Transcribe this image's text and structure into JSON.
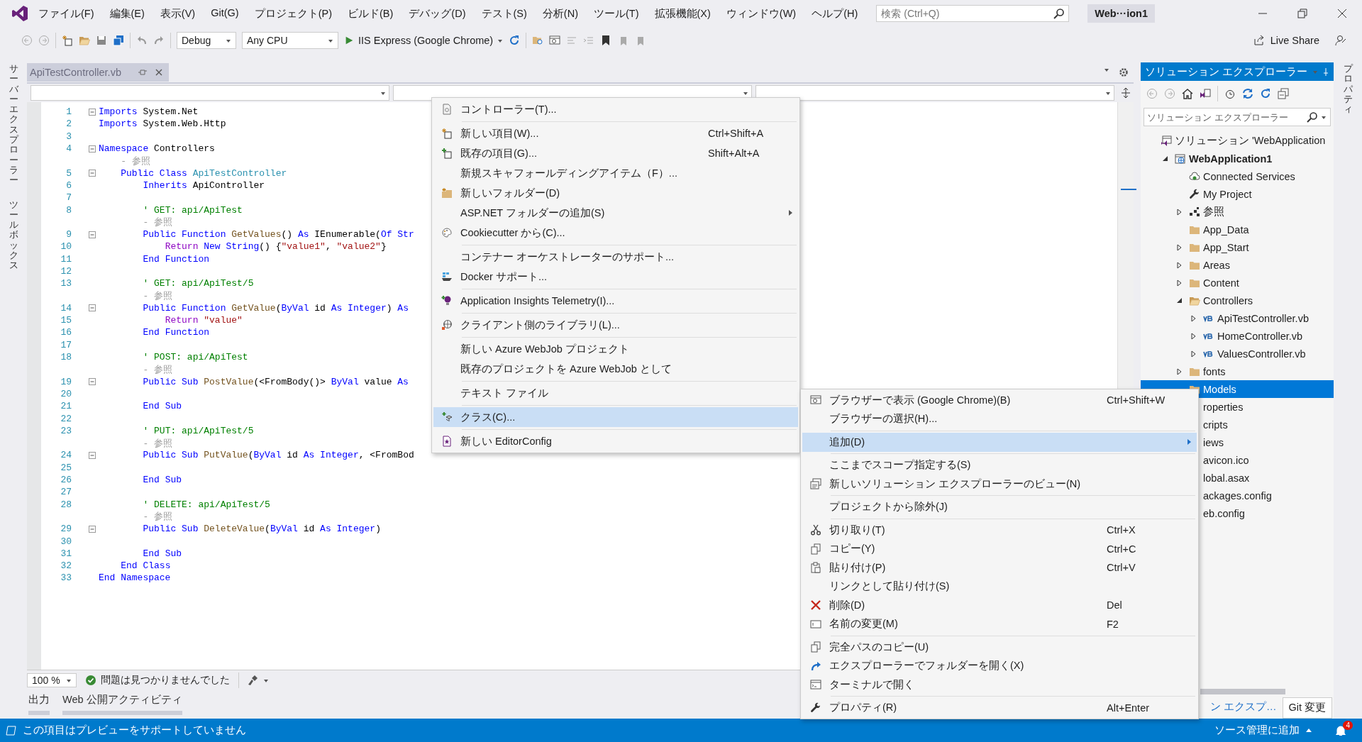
{
  "menu_bar": [
    "ファイル(F)",
    "編集(E)",
    "表示(V)",
    "Git(G)",
    "プロジェクト(P)",
    "ビルド(B)",
    "デバッグ(D)",
    "テスト(S)",
    "分析(N)",
    "ツール(T)",
    "拡張機能(X)",
    "ウィンドウ(W)",
    "ヘルプ(H)"
  ],
  "search": {
    "placeholder": "検索 (Ctrl+Q)"
  },
  "solution_badge": "Web···ion1",
  "toolbar": {
    "configuration": "Debug",
    "platform": "Any CPU",
    "run_target": "IIS Express (Google Chrome)",
    "live_share": "Live Share"
  },
  "side_tabs_left": [
    "サーバーエクスプローラー",
    "ツールボックス"
  ],
  "side_tabs_right": [
    "プロパティ"
  ],
  "document_tabs": [
    {
      "label": "ApiTestController.vb"
    }
  ],
  "editor": {
    "lines": [
      {
        "n": "1",
        "fold": true,
        "code": [
          {
            "kind": "keyword",
            "text": "Imports"
          },
          {
            "kind": "plain",
            "text": " System.Net"
          }
        ]
      },
      {
        "n": "2",
        "fold": false,
        "code": [
          {
            "kind": "keyword",
            "text": "Imports"
          },
          {
            "kind": "plain",
            "text": " System.Web.Http"
          }
        ]
      },
      {
        "n": "3",
        "fold": false
      },
      {
        "n": "4",
        "fold": true,
        "code": [
          {
            "kind": "keyword",
            "text": "Namespace"
          },
          {
            "kind": "plain",
            "text": " Controllers"
          }
        ]
      },
      {
        "fold": false,
        "code": [
          {
            "kind": "reference",
            "text": "    - 参照"
          }
        ]
      },
      {
        "n": "5",
        "fold": true,
        "code": [
          {
            "kind": "keyword",
            "text": "    Public Class"
          },
          {
            "kind": "type",
            "text": " ApiTestController"
          }
        ]
      },
      {
        "n": "6",
        "fold": false,
        "code": [
          {
            "kind": "keyword",
            "text": "        Inherits"
          },
          {
            "kind": "plain",
            "text": " ApiController"
          }
        ]
      },
      {
        "n": "7",
        "fold": false
      },
      {
        "n": "8",
        "fold": false,
        "code": [
          {
            "kind": "comment",
            "text": "        ' GET: api/ApiTest"
          }
        ]
      },
      {
        "fold": false,
        "code": [
          {
            "kind": "reference",
            "text": "        - 参照"
          }
        ]
      },
      {
        "n": "9",
        "fold": true,
        "code": [
          {
            "kind": "keyword",
            "text": "        Public Function"
          },
          {
            "kind": "method",
            "text": " GetValues"
          },
          {
            "kind": "plain",
            "text": "() "
          },
          {
            "kind": "keyword",
            "text": "As"
          },
          {
            "kind": "plain",
            "text": " IEnumerable("
          },
          {
            "kind": "keyword",
            "text": "Of Str"
          }
        ]
      },
      {
        "n": "10",
        "fold": false,
        "code": [
          {
            "kind": "control",
            "text": "            Return"
          },
          {
            "kind": "keyword",
            "text": " New String"
          },
          {
            "kind": "plain",
            "text": "() {"
          },
          {
            "kind": "string",
            "text": "\"value1\""
          },
          {
            "kind": "plain",
            "text": ", "
          },
          {
            "kind": "string",
            "text": "\"value2\""
          },
          {
            "kind": "plain",
            "text": "}"
          }
        ]
      },
      {
        "n": "11",
        "fold": false,
        "code": [
          {
            "kind": "keyword",
            "text": "        End Function"
          }
        ]
      },
      {
        "n": "12",
        "fold": false
      },
      {
        "n": "13",
        "fold": false,
        "code": [
          {
            "kind": "comment",
            "text": "        ' GET: api/ApiTest/5"
          }
        ]
      },
      {
        "fold": false,
        "code": [
          {
            "kind": "reference",
            "text": "        - 参照"
          }
        ]
      },
      {
        "n": "14",
        "fold": true,
        "code": [
          {
            "kind": "keyword",
            "text": "        Public Function"
          },
          {
            "kind": "method",
            "text": " GetValue"
          },
          {
            "kind": "plain",
            "text": "("
          },
          {
            "kind": "keyword",
            "text": "ByVal"
          },
          {
            "kind": "plain",
            "text": " id "
          },
          {
            "kind": "keyword",
            "text": "As Integer"
          },
          {
            "kind": "plain",
            "text": ") "
          },
          {
            "kind": "keyword",
            "text": "As"
          }
        ]
      },
      {
        "n": "15",
        "fold": false,
        "code": [
          {
            "kind": "control",
            "text": "            Return"
          },
          {
            "kind": "string",
            "text": " \"value\""
          }
        ]
      },
      {
        "n": "16",
        "fold": false,
        "code": [
          {
            "kind": "keyword",
            "text": "        End Function"
          }
        ]
      },
      {
        "n": "17",
        "fold": false
      },
      {
        "n": "18",
        "fold": false,
        "code": [
          {
            "kind": "comment",
            "text": "        ' POST: api/ApiTest"
          }
        ]
      },
      {
        "fold": false,
        "code": [
          {
            "kind": "reference",
            "text": "        - 参照"
          }
        ]
      },
      {
        "n": "19",
        "fold": true,
        "code": [
          {
            "kind": "keyword",
            "text": "        Public Sub"
          },
          {
            "kind": "method",
            "text": " PostValue"
          },
          {
            "kind": "plain",
            "text": "(<FromBody()> "
          },
          {
            "kind": "keyword",
            "text": "ByVal"
          },
          {
            "kind": "plain",
            "text": " value "
          },
          {
            "kind": "keyword",
            "text": "As"
          }
        ]
      },
      {
        "n": "20",
        "fold": false
      },
      {
        "n": "21",
        "fold": false,
        "code": [
          {
            "kind": "keyword",
            "text": "        End Sub"
          }
        ]
      },
      {
        "n": "22",
        "fold": false
      },
      {
        "n": "23",
        "fold": false,
        "code": [
          {
            "kind": "comment",
            "text": "        ' PUT: api/ApiTest/5"
          }
        ]
      },
      {
        "fold": false,
        "code": [
          {
            "kind": "reference",
            "text": "        - 参照"
          }
        ]
      },
      {
        "n": "24",
        "fold": true,
        "code": [
          {
            "kind": "keyword",
            "text": "        Public Sub"
          },
          {
            "kind": "method",
            "text": " PutValue"
          },
          {
            "kind": "plain",
            "text": "("
          },
          {
            "kind": "keyword",
            "text": "ByVal"
          },
          {
            "kind": "plain",
            "text": " id "
          },
          {
            "kind": "keyword",
            "text": "As Integer"
          },
          {
            "kind": "plain",
            "text": ", <FromBod"
          }
        ]
      },
      {
        "n": "25",
        "fold": false
      },
      {
        "n": "26",
        "fold": false,
        "code": [
          {
            "kind": "keyword",
            "text": "        End Sub"
          }
        ]
      },
      {
        "n": "27",
        "fold": false
      },
      {
        "n": "28",
        "fold": false,
        "code": [
          {
            "kind": "comment",
            "text": "        ' DELETE: api/ApiTest/5"
          }
        ]
      },
      {
        "fold": false,
        "code": [
          {
            "kind": "reference",
            "text": "        - 参照"
          }
        ]
      },
      {
        "n": "29",
        "fold": true,
        "code": [
          {
            "kind": "keyword",
            "text": "        Public Sub"
          },
          {
            "kind": "method",
            "text": " DeleteValue"
          },
          {
            "kind": "plain",
            "text": "("
          },
          {
            "kind": "keyword",
            "text": "ByVal"
          },
          {
            "kind": "plain",
            "text": " id "
          },
          {
            "kind": "keyword",
            "text": "As Integer"
          },
          {
            "kind": "plain",
            "text": ")"
          }
        ]
      },
      {
        "n": "30",
        "fold": false
      },
      {
        "n": "31",
        "fold": false,
        "code": [
          {
            "kind": "keyword",
            "text": "        End Sub"
          }
        ]
      },
      {
        "n": "32",
        "fold": false,
        "code": [
          {
            "kind": "keyword",
            "text": "    End Class"
          }
        ]
      },
      {
        "n": "33",
        "fold": false,
        "code": [
          {
            "kind": "keyword",
            "text": "End Namespace"
          }
        ]
      }
    ],
    "zoom": "100 %",
    "status": "問題は見つかりませんでした"
  },
  "output_tabs": [
    "出力",
    "Web 公開アクティビティ"
  ],
  "solution_explorer": {
    "title": "ソリューション エクスプローラー",
    "search_placeholder": "ソリューション エクスプローラー",
    "tree": [
      {
        "label": "ソリューション 'WebApplication",
        "kind": "solution",
        "selected": false,
        "children": [
          {
            "label": "WebApplication1",
            "kind": "project",
            "expanded": true,
            "selected": false,
            "children": [
              {
                "label": "Connected Services",
                "kind": "connected",
                "selected": false
              },
              {
                "label": "My Project",
                "kind": "settings",
                "selected": false
              },
              {
                "label": "参照",
                "kind": "references",
                "expanded": false,
                "selected": false
              },
              {
                "label": "App_Data",
                "kind": "folder",
                "selected": false
              },
              {
                "label": "App_Start",
                "kind": "folder",
                "expanded": false,
                "selected": false
              },
              {
                "label": "Areas",
                "kind": "folder",
                "expanded": false,
                "selected": false
              },
              {
                "label": "Content",
                "kind": "folder",
                "expanded": false,
                "selected": false
              },
              {
                "label": "Controllers",
                "kind": "folder",
                "expanded": true,
                "selected": false,
                "children": [
                  {
                    "label": "ApiTestController.vb",
                    "kind": "vb",
                    "expanded": false,
                    "selected": false
                  },
                  {
                    "label": "HomeController.vb",
                    "kind": "vb",
                    "expanded": false,
                    "selected": false
                  },
                  {
                    "label": "ValuesController.vb",
                    "kind": "vb",
                    "expanded": false,
                    "selected": false
                  }
                ]
              },
              {
                "label": "fonts",
                "kind": "folder",
                "expanded": false,
                "selected": false
              },
              {
                "label": "Models",
                "kind": "folder",
                "selected": true
              },
              {
                "label": "roperties",
                "kind": "text",
                "selected": false
              },
              {
                "label": "cripts",
                "kind": "text",
                "selected": false
              },
              {
                "label": "iews",
                "kind": "text",
                "selected": false
              },
              {
                "label": "avicon.ico",
                "kind": "text",
                "selected": false
              },
              {
                "label": "lobal.asax",
                "kind": "text",
                "selected": false
              },
              {
                "label": "ackages.config",
                "kind": "text",
                "selected": false
              },
              {
                "label": "eb.config",
                "kind": "text",
                "selected": false
              }
            ]
          }
        ]
      }
    ],
    "tabs": [
      {
        "label": "ン エクスプ…",
        "selected": true
      },
      {
        "label": "Git 変更",
        "selected": false
      }
    ]
  },
  "status_bar": {
    "message": "この項目はプレビューをサポートしていません",
    "source_control": "ソース管理に追加",
    "notifications": "4"
  },
  "add_submenu": {
    "items": [
      {
        "kind": "item",
        "label": "コントローラー(T)...",
        "selected": false
      },
      {
        "kind": "separator"
      },
      {
        "kind": "item",
        "label": "新しい項目(W)...",
        "shortcut": "Ctrl+Shift+A",
        "selected": false
      },
      {
        "kind": "item",
        "label": "既存の項目(G)...",
        "shortcut": "Shift+Alt+A",
        "selected": false
      },
      {
        "kind": "item",
        "label": "新規スキャフォールディングアイテム（F）...",
        "selected": false
      },
      {
        "kind": "item",
        "label": "新しいフォルダー(D)",
        "selected": false
      },
      {
        "kind": "submenu",
        "label": "ASP.NET フォルダーの追加(S)",
        "selected": false
      },
      {
        "kind": "item",
        "label": "Cookiecutter から(C)...",
        "selected": false
      },
      {
        "kind": "separator"
      },
      {
        "kind": "item",
        "label": "コンテナー オーケストレーターのサポート...",
        "selected": false
      },
      {
        "kind": "item",
        "label": "Docker サポート...",
        "selected": false
      },
      {
        "kind": "separator"
      },
      {
        "kind": "item",
        "label": "Application Insights Telemetry(I)...",
        "selected": false
      },
      {
        "kind": "separator"
      },
      {
        "kind": "item",
        "label": "クライアント側のライブラリ(L)...",
        "selected": false
      },
      {
        "kind": "separator"
      },
      {
        "kind": "item",
        "label": "新しい Azure WebJob プロジェクト",
        "selected": false
      },
      {
        "kind": "item",
        "label": "既存のプロジェクトを Azure WebJob として",
        "selected": false
      },
      {
        "kind": "separator"
      },
      {
        "kind": "item",
        "label": "テキスト ファイル",
        "selected": false
      },
      {
        "kind": "separator"
      },
      {
        "kind": "item",
        "label": "クラス(C)...",
        "selected": true
      },
      {
        "kind": "separator"
      },
      {
        "kind": "item",
        "label": "新しい EditorConfig",
        "selected": false
      }
    ]
  },
  "context_menu": {
    "items": [
      {
        "kind": "item",
        "label": "ブラウザーで表示 (Google Chrome)(B)",
        "shortcut": "Ctrl+Shift+W",
        "selected": false
      },
      {
        "kind": "item",
        "label": "ブラウザーの選択(H)...",
        "selected": false
      },
      {
        "kind": "separator"
      },
      {
        "kind": "submenu",
        "label": "追加(D)",
        "selected": true
      },
      {
        "kind": "separator"
      },
      {
        "kind": "item",
        "label": "ここまでスコープ指定する(S)",
        "selected": false
      },
      {
        "kind": "item",
        "label": "新しいソリューション エクスプローラーのビュー(N)",
        "selected": false
      },
      {
        "kind": "separator"
      },
      {
        "kind": "item",
        "label": "プロジェクトから除外(J)",
        "selected": false
      },
      {
        "kind": "separator"
      },
      {
        "kind": "item",
        "label": "切り取り(T)",
        "shortcut": "Ctrl+X",
        "selected": false
      },
      {
        "kind": "item",
        "label": "コピー(Y)",
        "shortcut": "Ctrl+C",
        "selected": false
      },
      {
        "kind": "item",
        "label": "貼り付け(P)",
        "shortcut": "Ctrl+V",
        "selected": false
      },
      {
        "kind": "item",
        "label": "リンクとして貼り付け(S)",
        "selected": false
      },
      {
        "kind": "item",
        "label": "削除(D)",
        "shortcut": "Del",
        "selected": false
      },
      {
        "kind": "item",
        "label": "名前の変更(M)",
        "shortcut": "F2",
        "selected": false
      },
      {
        "kind": "separator"
      },
      {
        "kind": "item",
        "label": "完全パスのコピー(U)",
        "selected": false
      },
      {
        "kind": "item",
        "label": "エクスプローラーでフォルダーを開く(X)",
        "selected": false
      },
      {
        "kind": "item",
        "label": "ターミナルで開く",
        "selected": false
      },
      {
        "kind": "separator"
      },
      {
        "kind": "item",
        "label": "プロパティ(R)",
        "shortcut": "Alt+Enter",
        "selected": false
      }
    ]
  }
}
